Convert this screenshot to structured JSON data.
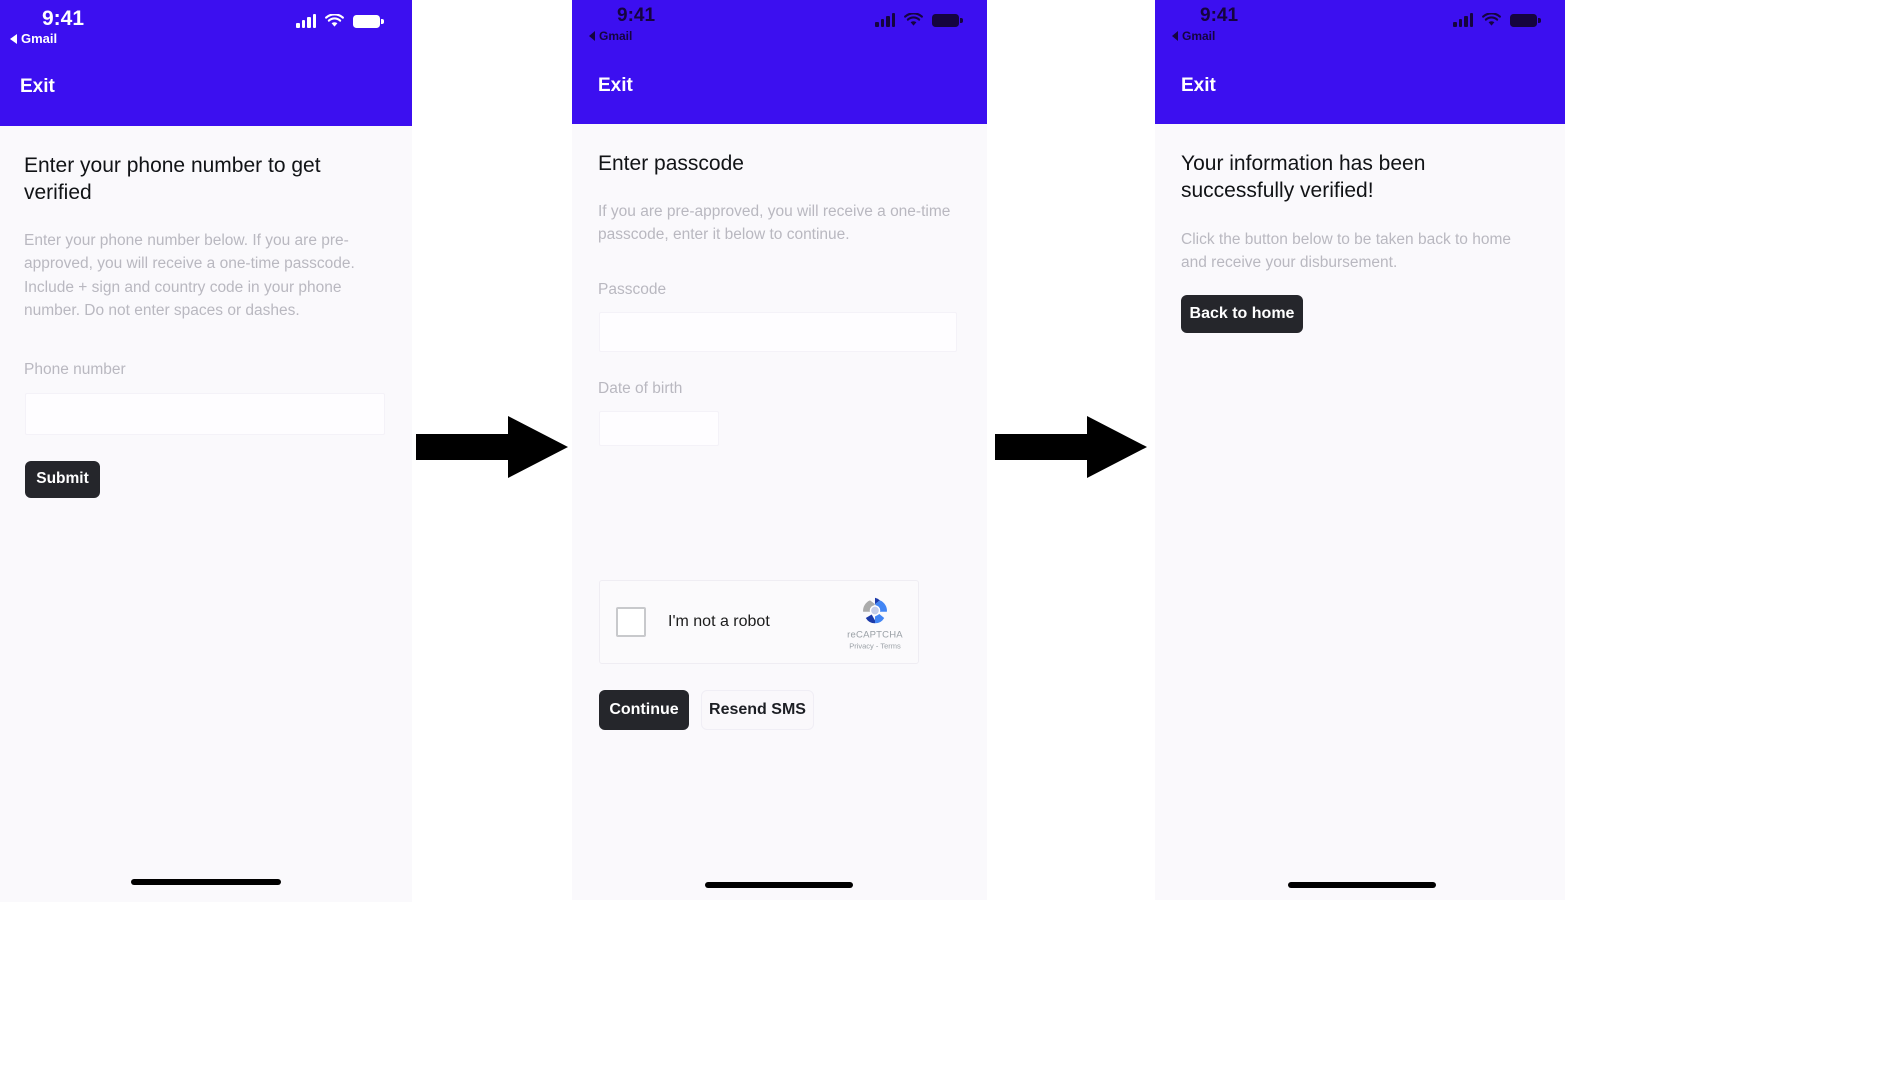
{
  "theme": {
    "header_purple": "#3c0ff0",
    "page_bg": "#faf9fc",
    "dark_button": "#25262b",
    "muted_text": "#b9b8c0",
    "title_text": "#111316"
  },
  "status_bar": {
    "time": "9:41",
    "back_app": "Gmail",
    "signal_icon": "signal-bars-icon",
    "wifi_icon": "wifi-icon",
    "battery_icon": "battery-icon"
  },
  "screens": [
    {
      "id": "phone-1",
      "exit_label": "Exit",
      "title": "Enter your phone number to get verified",
      "paragraph": "Enter your phone number below. If you are pre-approved, you will receive a one-time passcode. Include + sign and country code in your phone number. Do not enter spaces or dashes.",
      "field_label": "Phone number",
      "field_value": "",
      "field_placeholder": "",
      "submit_label": "Submit"
    },
    {
      "id": "phone-2",
      "exit_label": "Exit",
      "title": "Enter passcode",
      "paragraph": "If you are pre-approved, you will receive a one-time passcode, enter it below to continue.",
      "passcode_label": "Passcode",
      "passcode_value": "",
      "passcode_placeholder": "",
      "dob_label": "Date of birth",
      "dob_value": "",
      "dob_placeholder": "",
      "recaptcha": {
        "checkbox_label": "I'm not a robot",
        "brand": "reCAPTCHA",
        "legal": "Privacy - Terms",
        "checked": false
      },
      "continue_label": "Continue",
      "resend_label": "Resend SMS"
    },
    {
      "id": "phone-3",
      "exit_label": "Exit",
      "title": "Your information has been successfully verified!",
      "paragraph": "Click the button below to be taken back to home and receive your disbursement.",
      "back_home_label": "Back to home"
    }
  ],
  "arrows": [
    {
      "name": "arrow-step-1-to-2"
    },
    {
      "name": "arrow-step-2-to-3"
    }
  ]
}
